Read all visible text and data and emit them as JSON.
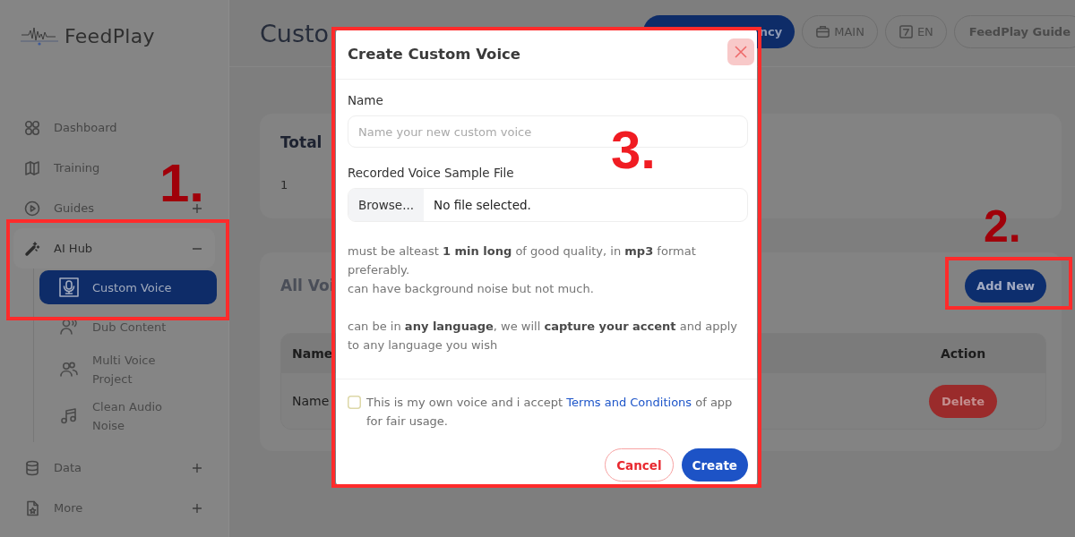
{
  "sidebar": {
    "logo": "FeedPlay",
    "items": [
      {
        "label": "Dashboard"
      },
      {
        "label": "Training"
      },
      {
        "label": "Guides",
        "expanded": false
      },
      {
        "label": "AI Hub",
        "expanded": true,
        "children": [
          {
            "label": "Custom Voice",
            "selected": true
          },
          {
            "label": "Dub Content",
            "selected": false
          },
          {
            "label": "Multi Voice Project",
            "selected": false
          },
          {
            "label": "Clean Audio Noise",
            "selected": false
          }
        ]
      },
      {
        "label": "Data",
        "expanded": false
      },
      {
        "label": "More",
        "expanded": false
      }
    ]
  },
  "header": {
    "title": "Custo",
    "buttons": [
      {
        "label": "ncy",
        "kind": "primary"
      },
      {
        "label": "MAIN",
        "kind": "outline"
      },
      {
        "label": "EN",
        "kind": "outline"
      },
      {
        "label": "FeedPlay Guide",
        "kind": "outline"
      }
    ]
  },
  "summary": {
    "title": "Total",
    "value": "1"
  },
  "voices": {
    "title": "All Voi",
    "add_button": "Add New",
    "columns": [
      {
        "label": "Name"
      },
      {
        "label": "Action"
      }
    ],
    "rows": [
      {
        "name": "Name",
        "action": "Delete"
      }
    ]
  },
  "modal": {
    "title": "Create Custom Voice",
    "name_label": "Name",
    "name_placeholder": "Name your new custom voice",
    "file_label": "Recorded Voice Sample File",
    "browse": "Browse...",
    "file_status": "No file selected.",
    "help": [
      "must be alteast **1 min long** of good quality, in **mp3** format preferably.",
      "can have background noise but not much.",
      "can be in **any language**, we will **capture your accent** and apply to any language you wish"
    ],
    "consent": {
      "checked": false,
      "before": "This is my own voice and i accept ",
      "link": "Terms and Conditions",
      "after": " of app for fair usage."
    },
    "cancel": "Cancel",
    "create": "Create"
  },
  "annotations": [
    {
      "label": "1."
    },
    {
      "label": "2."
    },
    {
      "label": "3."
    }
  ]
}
